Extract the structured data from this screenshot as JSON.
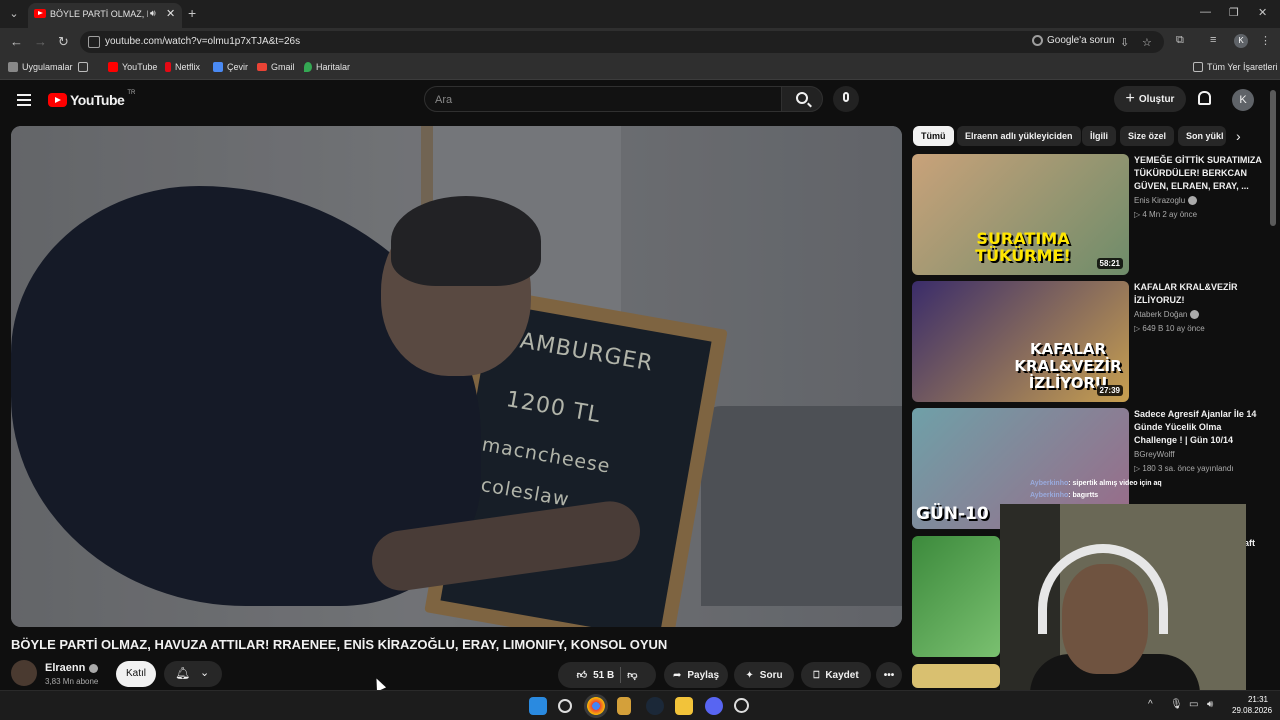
{
  "browser": {
    "tab_title": "BÖYLE PARTİ OLMAZ, HAVU",
    "url": "youtube.com/watch?v=olmu1p7xTJA&t=26s",
    "google_ask": "Google'a sorun",
    "profile_initial": "K",
    "bookmarks": [
      "Uygulamalar",
      "YouTube",
      "Netflix",
      "Çevir",
      "Gmail",
      "Haritalar"
    ],
    "all_bookmarks": "Tüm Yer İşaretleri"
  },
  "header": {
    "logo_text": "YouTube",
    "region": "TR",
    "search_placeholder": "Ara",
    "create_label": "Oluştur",
    "avatar_initial": "K"
  },
  "video": {
    "title": "BÖYLE PARTİ OLMAZ, HAVUZA ATTILAR! RRAENEE, ENİS KİRAZOĞLU, ERAY, LIMONIFY, KONSOL OYUN",
    "chalk_lines": [
      "HAMBURGER",
      "1200 TL",
      "macncheese",
      "coleslaw"
    ],
    "channel": "Elraenn",
    "subscribers": "3,83 Mn abone",
    "join_label": "Katıl",
    "likes": "51 B",
    "share_label": "Paylaş",
    "ask_label": "Soru",
    "save_label": "Kaydet"
  },
  "chips": [
    "Tümü",
    "Elraenn adlı yükleyiciden",
    "İlgili",
    "Size özel",
    "Son yükl"
  ],
  "recommendations": [
    {
      "title": "YEMEĞE GİTTİK SURATIMIZA TÜKÜRDÜLER! BERKCAN GÜVEN, ELRAEN, ERAY, ...",
      "channel": "Enis Kirazoglu",
      "meta": "4 Mn  2 ay önce",
      "duration": "58:21",
      "thumb_text": "SURATIMA TÜKÜRME!",
      "colors": [
        "#c9a27a",
        "#6e8c6a"
      ]
    },
    {
      "title": "KAFALAR KRAL&VEZİR İZLİYORUZ!",
      "channel": "Ataberk Doğan",
      "meta": "649 B  10 ay önce",
      "duration": "27:39",
      "thumb_text": "KAFALAR KRAL&VEZİR İZLİYORU",
      "colors": [
        "#3a2c6a",
        "#c8a050"
      ]
    },
    {
      "title": "Sadece Agresif Ajanlar İle 14 Günde Yücelik Olma Challenge ! | Gün 10/14",
      "channel": "BGreyWolff",
      "meta": "180  3 sa. önce yayınlandı",
      "duration": "",
      "thumb_text": "GÜN-10",
      "colors": [
        "#6fa0a8",
        "#9a6a88"
      ]
    },
    {
      "title": "",
      "channel": "",
      "meta": "",
      "duration": "",
      "thumb_text": "",
      "colors": [
        "#3c8a3c",
        "#7ac070"
      ]
    }
  ],
  "chat": [
    {
      "user": "Ayberkinho",
      "text": "sipertik almış video için aq"
    },
    {
      "user": "Ayberkinho",
      "text": "bagırtts"
    }
  ],
  "partial_text": "aft",
  "taskbar": {
    "time": "21:31",
    "date": "29.08.2026"
  }
}
